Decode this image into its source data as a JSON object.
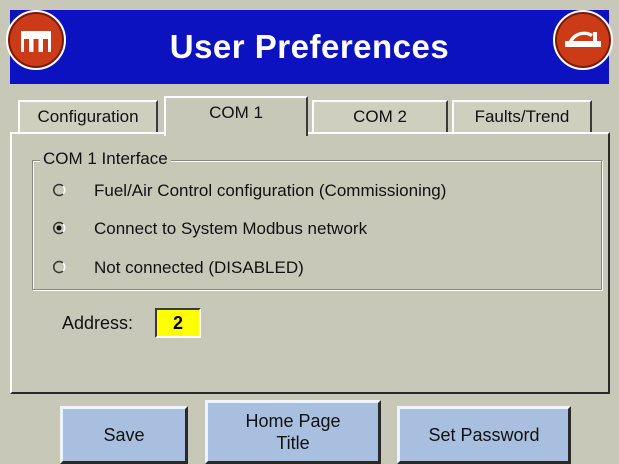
{
  "header": {
    "title": "User Preferences",
    "home_icon": "home-icon",
    "exit_icon": "exit-icon"
  },
  "tabs": [
    {
      "label": "Configuration",
      "active": false
    },
    {
      "label": "COM 1",
      "active": true
    },
    {
      "label": "COM 2",
      "active": false
    },
    {
      "label": "Faults/Trend",
      "active": false
    }
  ],
  "interface_group": {
    "legend": "COM 1 Interface",
    "options": [
      {
        "label": "Fuel/Air Control configuration (Commissioning)",
        "selected": false
      },
      {
        "label": "Connect to System Modbus network",
        "selected": true
      },
      {
        "label": "Not connected (DISABLED)",
        "selected": false
      }
    ]
  },
  "address": {
    "label": "Address:",
    "value": "2"
  },
  "buttons": {
    "save": "Save",
    "home_page_title_line1": "Home Page",
    "home_page_title_line2": "Title",
    "set_password": "Set Password"
  },
  "colors": {
    "title_bar": "#0c12c0",
    "background": "#c8c8b8",
    "round_button": "#cc3b17",
    "address_highlight": "#ffff00",
    "action_button": "#a9bfe0"
  }
}
